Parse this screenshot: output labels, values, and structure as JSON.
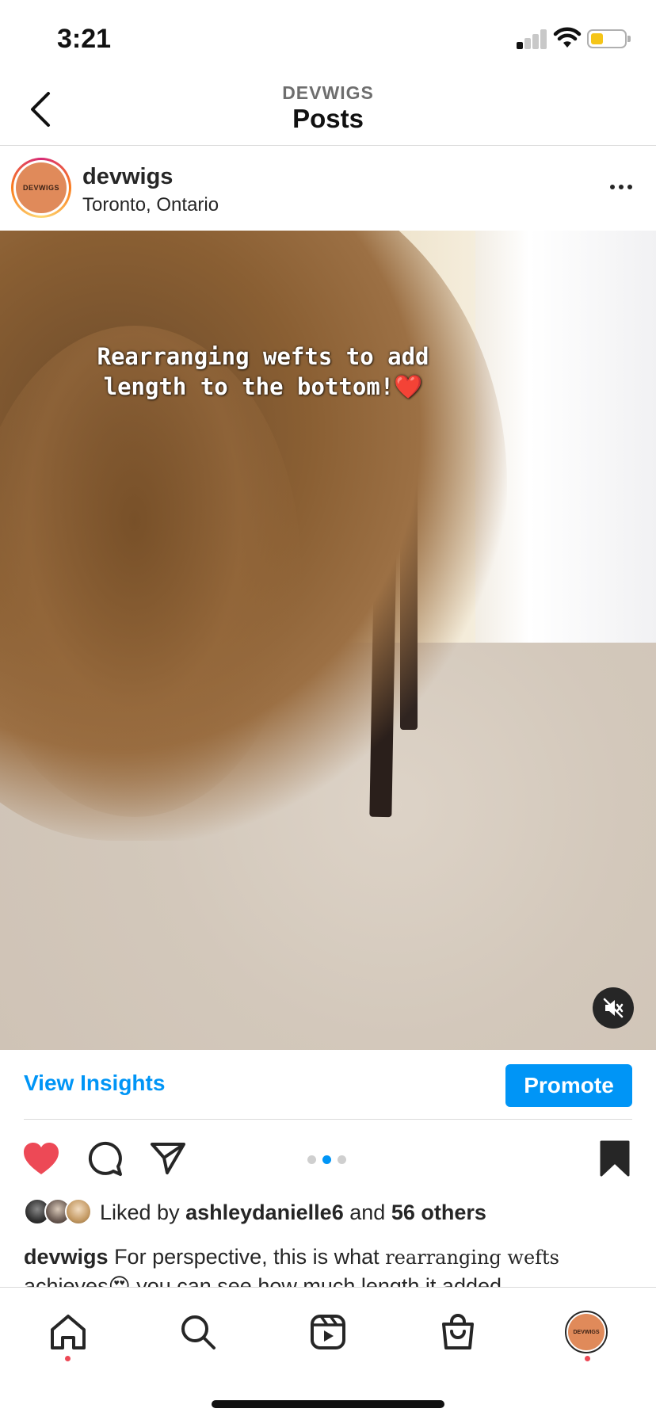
{
  "status_bar": {
    "time": "3:21"
  },
  "header": {
    "account": "DEVWIGS",
    "title": "Posts"
  },
  "post": {
    "username": "devwigs",
    "location": "Toronto, Ontario",
    "avatar_text": "DEVWIGS",
    "overlay_text_line1": "Rearranging wefts to add",
    "overlay_text_line2": "length to the bottom!",
    "overlay_emoji": "❤️",
    "carousel": {
      "count": 3,
      "active_index": 1
    }
  },
  "insights": {
    "view_insights_label": "View Insights",
    "promote_label": "Promote"
  },
  "likes": {
    "prefix": "Liked by",
    "user": "ashleydanielle6",
    "connector": "and",
    "others": "56 others"
  },
  "caption": {
    "username": "devwigs",
    "text": "For perspective, this is what",
    "styled_text": "rearranging wefts",
    "line2": "achieves😍  you can see how much length it added"
  },
  "icons": {
    "like": "heart-filled-icon",
    "comment": "comment-icon",
    "share": "send-icon",
    "save": "bookmark-filled-icon",
    "mute": "speaker-muted-icon",
    "back": "chevron-left-icon",
    "more": "more-horizontal-icon"
  },
  "colors": {
    "accent_blue": "#0095f6",
    "like_red": "#ed4956",
    "battery_yellow": "#f5c518"
  },
  "tab_bar": {
    "items": [
      "home",
      "search",
      "reels",
      "shop",
      "profile"
    ],
    "profile_avatar_text": "DEVWIGS"
  }
}
